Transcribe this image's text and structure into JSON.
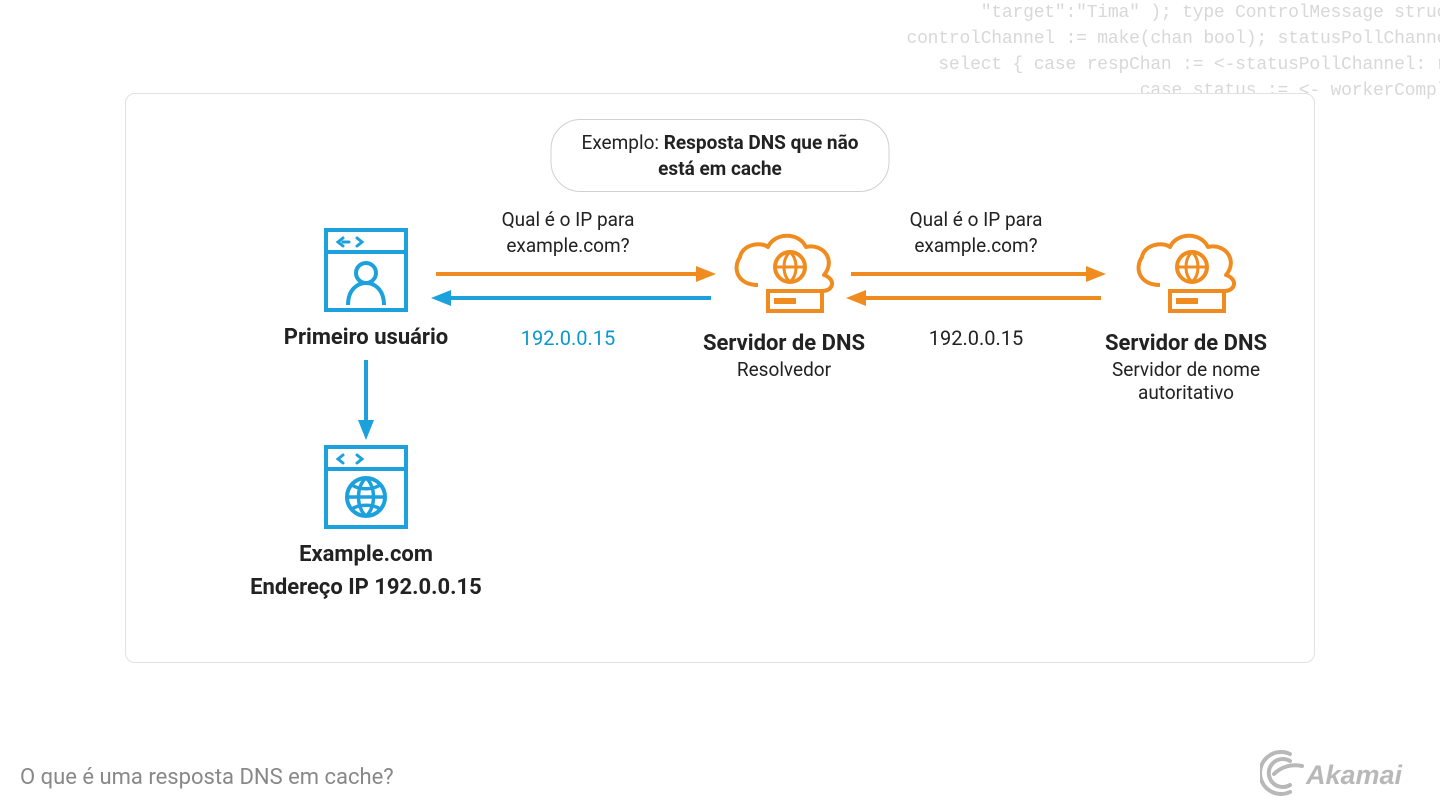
{
  "background_code": "                                                   \"target\":\"Tima\" ); type ControlMessage struct { Target string; Cou\n                                            controlChannel := make(chan bool); statusPollChannel := make(chan chan bool); w\n                                               select { case respChan := <-statusPollChannel: respChan <- workerActive; case \n                                                                  case status := <- workerCompleteChan: workerActive = status;\n                                                                                                                 t) { hostTok\n                                                                                                                 .Fprintf(w, \n                                                                                                                 sued for Tar\n                                                                                                                  { reqChan  \n                                                                                                                 w, \"ACTIVE\" \n                                                                                                                 nil)); };pac\n                                                                                                                 }; func mai\n                                                                                                                 ; workerActi\n                                                                                                                 se msg := <-\n                                                                                                                 func admin(c\n                                                                                                                 hostTokens  \n                                                                                                                 .Fprintf(w, \n                                                                                                                 sued for Tar\n                                                                                                                  { reqChan  \n                                                                                                                   \"ACTIVE\"  \n                                                                                                                 nil));  ;pac\n                                                                                                                    func mai\n                                                                                                                 ; workerActi\n                                                                                                                 ",
  "title": {
    "prefix": "Exemplo: ",
    "bold_line1": "Resposta DNS que não",
    "bold_line2": "está em cache"
  },
  "nodes": {
    "user": {
      "label": "Primeiro usuário"
    },
    "resolver": {
      "label": "Servidor de DNS",
      "sublabel": "Resolvedor"
    },
    "authoritative": {
      "label": "Servidor de DNS",
      "sublabel": "Servidor de nome autoritativo"
    },
    "website": {
      "label": "Example.com",
      "sublabel": "Endereço IP 192.0.0.15"
    }
  },
  "arrows": {
    "query1": {
      "line1": "Qual é o IP para",
      "line2": "example.com?"
    },
    "query2": {
      "line1": "Qual é o IP para",
      "line2": "example.com?"
    },
    "response1": "192.0.0.15",
    "response2": "192.0.0.15"
  },
  "colors": {
    "blue": "#1da1dd",
    "orange": "#f08c1f"
  },
  "footer_question": "O que é uma resposta DNS em cache?",
  "brand": "Akamai"
}
